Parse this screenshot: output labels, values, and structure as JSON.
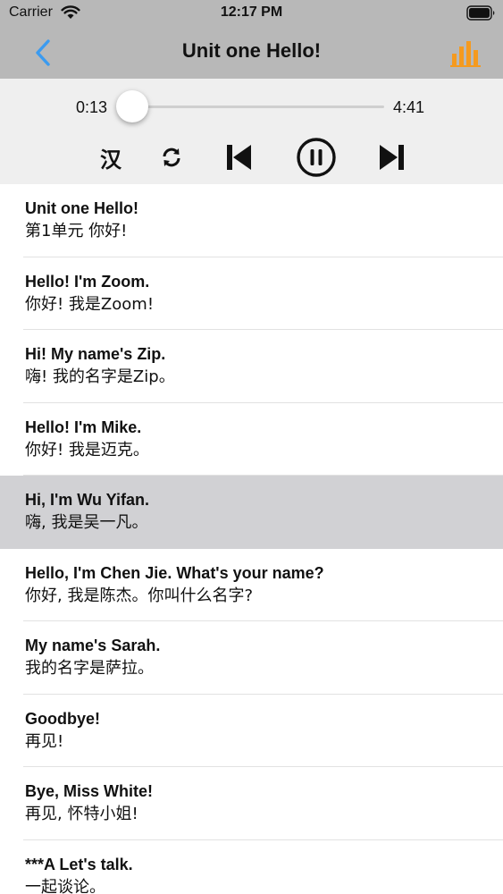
{
  "status": {
    "carrier": "Carrier",
    "time": "12:17 PM"
  },
  "nav": {
    "title": "Unit one Hello!",
    "back_icon": "chevron-left-icon",
    "right_icon": "bar-chart-icon",
    "accent": "#f59a1f",
    "back_color": "#3b9bf0"
  },
  "player": {
    "current_time": "0:13",
    "total_time": "4:41",
    "progress": 0.046,
    "lang_toggle": "汉",
    "accent": "#2a8ae8"
  },
  "sentences": [
    {
      "en": "Unit one Hello!",
      "cn": "第1单元 你好!"
    },
    {
      "en": "Hello! I'm Zoom.",
      "cn": "你好! 我是Zoom!"
    },
    {
      "en": "Hi! My name's Zip.",
      "cn": "嗨! 我的名字是Zip。"
    },
    {
      "en": "Hello! I'm Mike.",
      "cn": "你好! 我是迈克。"
    },
    {
      "en": "Hi, I'm Wu Yifan.",
      "cn": "嗨, 我是吴一凡。"
    },
    {
      "en": "Hello, I'm Chen Jie. What's your name?",
      "cn": "你好, 我是陈杰。你叫什么名字?"
    },
    {
      "en": "My name's Sarah.",
      "cn": "我的名字是萨拉。"
    },
    {
      "en": "Goodbye!",
      "cn": "再见!"
    },
    {
      "en": "Bye, Miss White!",
      "cn": "再见, 怀特小姐!"
    },
    {
      "en": "***A Let's talk.",
      "cn": "一起谈论。"
    }
  ],
  "selected_index": 4
}
